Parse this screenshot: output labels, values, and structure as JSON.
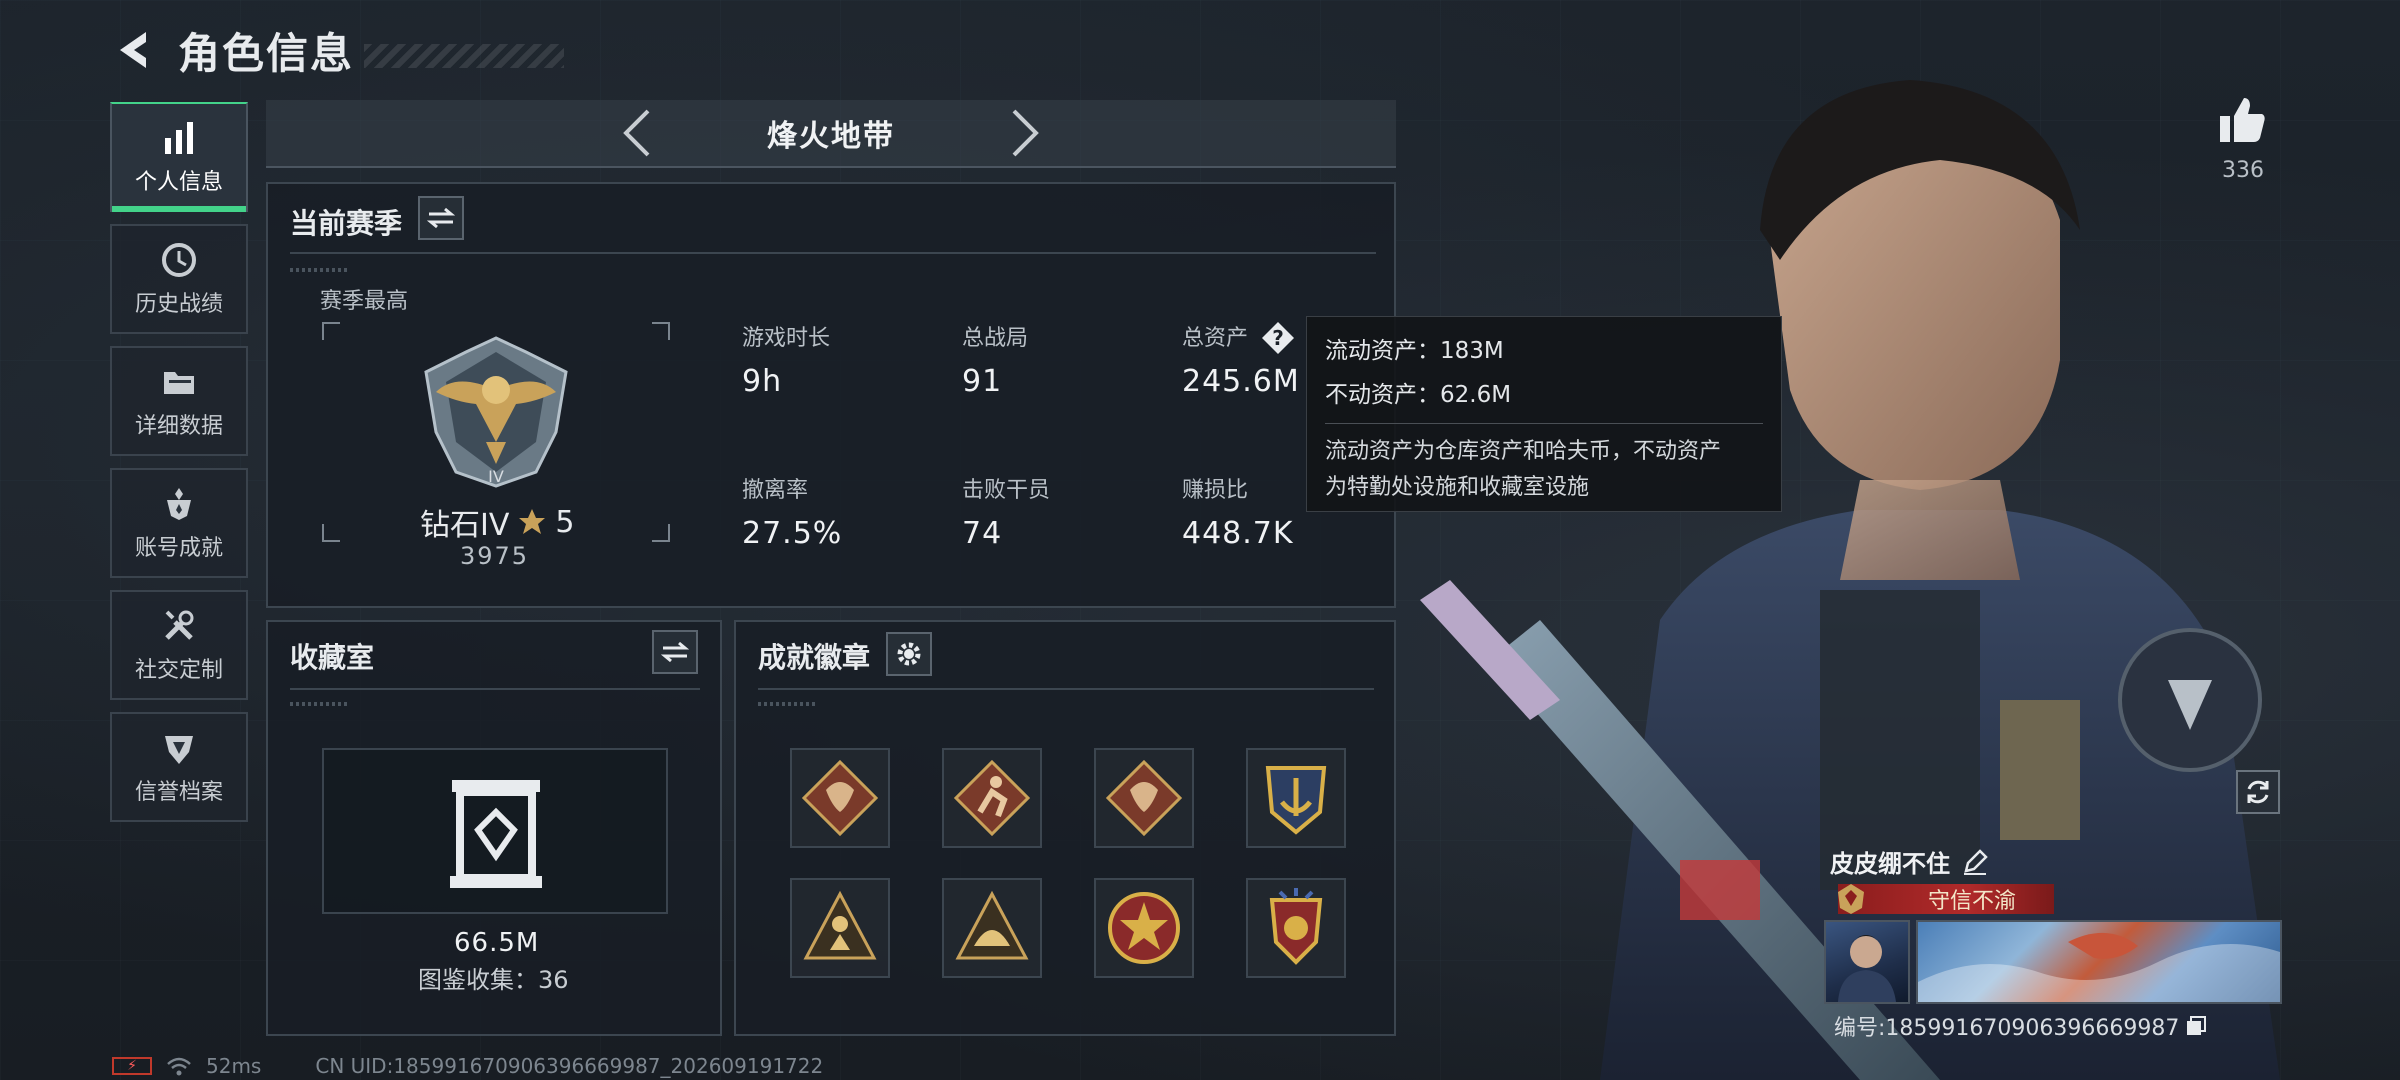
{
  "header": {
    "title": "角色信息"
  },
  "sidebar": {
    "items": [
      {
        "label": "个人信息",
        "icon": "bar-chart-icon",
        "active": true
      },
      {
        "label": "历史战绩",
        "icon": "history-clock-icon",
        "active": false
      },
      {
        "label": "详细数据",
        "icon": "folder-icon",
        "active": false
      },
      {
        "label": "账号成就",
        "icon": "achievement-icon",
        "active": false
      },
      {
        "label": "社交定制",
        "icon": "tools-icon",
        "active": false
      },
      {
        "label": "信誉档案",
        "icon": "shield-badge-icon",
        "active": false
      }
    ]
  },
  "mode": {
    "name": "烽火地带"
  },
  "season": {
    "title": "当前赛季",
    "best_label": "赛季最高",
    "rank_name": "钻石IV",
    "rank_stars": "5",
    "rank_points": "3975",
    "stats": [
      {
        "label": "游戏时长",
        "value": "9h"
      },
      {
        "label": "总战局",
        "value": "91"
      },
      {
        "label": "总资产",
        "value": "245.6M"
      },
      {
        "label": "撤离率",
        "value": "27.5%"
      },
      {
        "label": "击败干员",
        "value": "74"
      },
      {
        "label": "赚损比",
        "value": "448.7K"
      }
    ]
  },
  "tooltip": {
    "liquid": "流动资产：183M",
    "fixed": "不动资产：62.6M",
    "desc_line1": "流动资产为仓库资产和哈夫币，不动资产",
    "desc_line2": "为特勤处设施和收藏室设施"
  },
  "collection": {
    "title": "收藏室",
    "value": "66.5M",
    "count_text": "图鉴收集：36"
  },
  "achievements": {
    "title": "成就徽章",
    "badges": [
      "dragon-badge-icon",
      "runner-badge-icon",
      "dragon-badge-icon",
      "anchor-badge-icon",
      "soldier-badge-icon",
      "helmet-badge-icon",
      "star-badge-icon",
      "shield-wings-badge-icon"
    ]
  },
  "profile": {
    "like_count": "336",
    "player_name": "皮皮绷不住",
    "title_badge": "守信不渝",
    "player_id": "编号:185991670906396669987"
  },
  "footer": {
    "ping": "52ms",
    "uid": "CN UID:185991670906396669987_202609191722"
  },
  "colors": {
    "accent": "#43d38a",
    "title_red": "#b12a2a",
    "gold": "#c9a25a"
  }
}
